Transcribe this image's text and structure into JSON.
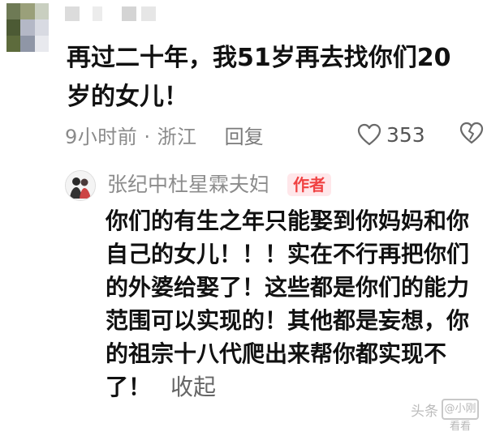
{
  "comment": {
    "text": "再过二十年，我51岁再去找你们20岁的女儿！",
    "time_location": "9小时前 · 浙江",
    "reply_label": "回复",
    "like_count": "353"
  },
  "author_reply": {
    "author_name": "张纪中杜星霖夫妇",
    "badge": "作者",
    "text": "你们的有生之年只能娶到你妈妈和你自己的女儿！！！实在不行再把你们的外婆给娶了！这些都是你们的能力范围可以实现的！其他都是妄想，你的祖宗十八代爬出来帮你都实现不了！",
    "collapse_label": "收起"
  },
  "watermark": {
    "prefix": "头条",
    "handle": "@小刚看看"
  },
  "colors": {
    "badge_bg": "#ffe7ea",
    "badge_text": "#f04142",
    "meta_gray": "#8a8a8a"
  },
  "icons": {
    "like": "heart-outline-icon",
    "dislike": "broken-heart-icon"
  }
}
